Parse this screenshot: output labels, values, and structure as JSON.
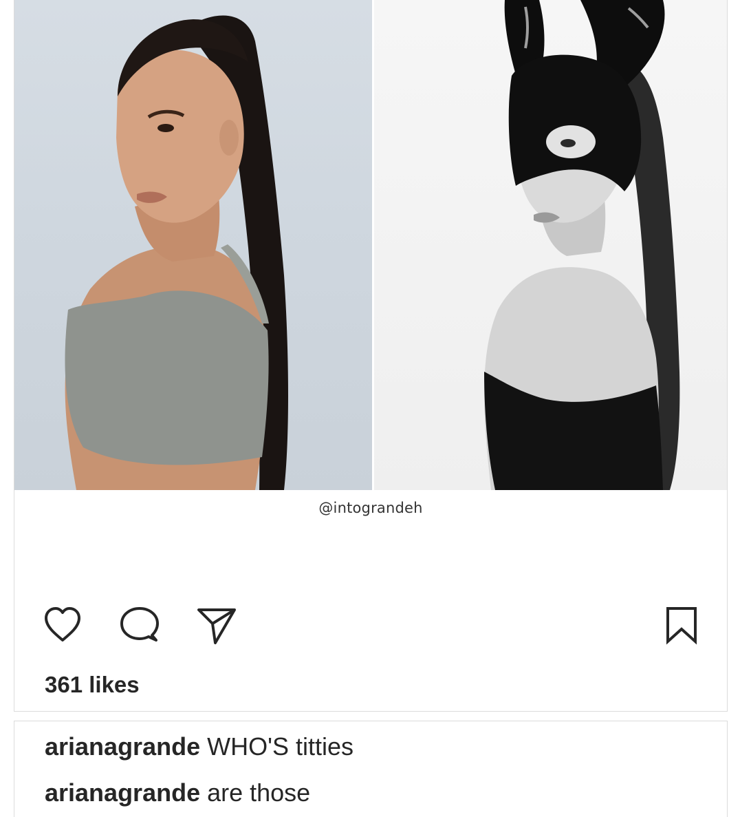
{
  "post": {
    "watermark": "@intograndeh",
    "likes_text": "361 likes"
  },
  "actions": {
    "like_icon": "heart-outline-icon",
    "comment_icon": "speech-bubble-icon",
    "share_icon": "paper-plane-icon",
    "save_icon": "bookmark-outline-icon"
  },
  "comments": [
    {
      "username": "arianagrande",
      "text": "WHO'S titties"
    },
    {
      "username": "arianagrande",
      "text": "are those"
    }
  ],
  "colors": {
    "text": "#262626",
    "border": "#dbdbdb",
    "background": "#ffffff"
  }
}
